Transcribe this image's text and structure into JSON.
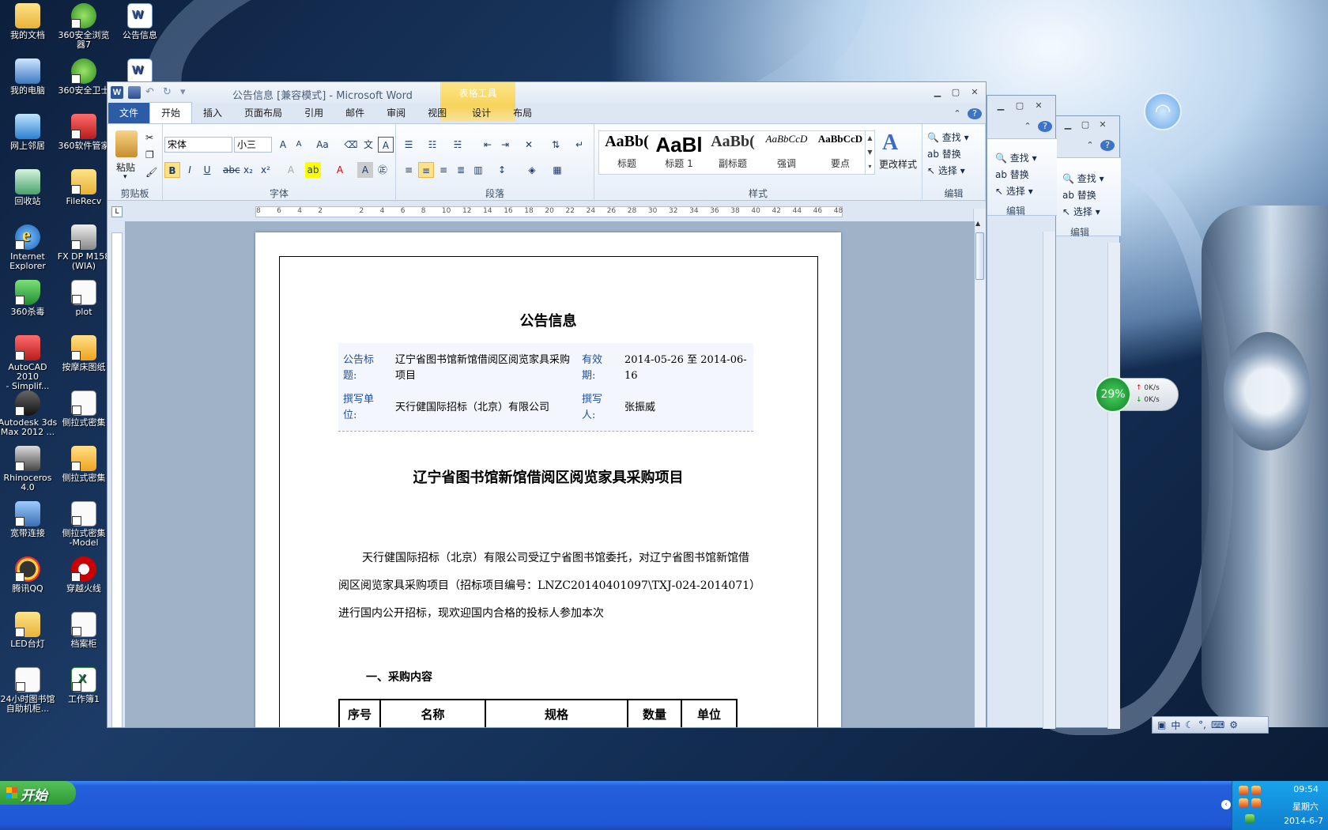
{
  "desktop_icons": [
    {
      "label": "我的文档",
      "icon": "folder-icon"
    },
    {
      "label": "360安全浏览\n器7",
      "icon": "browser-icon"
    },
    {
      "label": "公告信息",
      "icon": "word-doc-icon"
    },
    {
      "label": "我的电脑",
      "icon": "computer-icon"
    },
    {
      "label": "360安全卫士",
      "icon": "shield-icon"
    },
    {
      "label": "",
      "icon": "word-doc-icon"
    },
    {
      "label": "网上邻居",
      "icon": "network-icon"
    },
    {
      "label": "360软件管家",
      "icon": "app-manager-icon"
    },
    {
      "label": "回收站",
      "icon": "recycle-bin-icon"
    },
    {
      "label": "FileRecv",
      "icon": "folder-icon"
    },
    {
      "label": "Internet\nExplorer",
      "icon": "ie-icon"
    },
    {
      "label": "FX DP M158\n(WIA)",
      "icon": "scanner-icon"
    },
    {
      "label": "360杀毒",
      "icon": "antivirus-icon"
    },
    {
      "label": "plot",
      "icon": "file-icon"
    },
    {
      "label": "AutoCAD 2010\n- Simplif...",
      "icon": "autocad-icon"
    },
    {
      "label": "按摩床图纸",
      "icon": "dwg-icon"
    },
    {
      "label": "Autodesk 3ds\nMax 2012 ...",
      "icon": "3dsmax-icon"
    },
    {
      "label": "侧拉式密集",
      "icon": "file-icon"
    },
    {
      "label": "Rhinoceros\n4.0",
      "icon": "rhino-icon"
    },
    {
      "label": "侧拉式密集",
      "icon": "dwg-icon"
    },
    {
      "label": "宽带连接",
      "icon": "broadband-icon"
    },
    {
      "label": "侧拉式密集\n-Model",
      "icon": "file-icon"
    },
    {
      "label": "腾讯QQ",
      "icon": "qq-icon"
    },
    {
      "label": "穿越火线",
      "icon": "game-icon"
    },
    {
      "label": "LED台灯",
      "icon": "folder-icon"
    },
    {
      "label": "档案柜",
      "icon": "file-icon"
    },
    {
      "label": "24小时图书馆\n自助机柜...",
      "icon": "file-icon"
    },
    {
      "label": "工作簿1",
      "icon": "excel-icon"
    }
  ],
  "word": {
    "title": "公告信息 [兼容模式] - Microsoft Word",
    "context_tab": "表格工具",
    "tabs": [
      "文件",
      "开始",
      "插入",
      "页面布局",
      "引用",
      "邮件",
      "审阅",
      "视图",
      "设计",
      "布局"
    ],
    "font_name": "宋体",
    "font_size": "小三",
    "groups": {
      "clipboard": "剪贴板",
      "font": "字体",
      "paragraph": "段落",
      "styles": "样式",
      "editing": "编辑"
    },
    "paste_label": "粘贴",
    "styles": [
      {
        "preview": "AaBb(",
        "name": "标题"
      },
      {
        "preview": "AaBl",
        "name": "标题 1"
      },
      {
        "preview": "AaBb(",
        "name": "副标题"
      },
      {
        "preview": "AaBbCcD",
        "name": "强调"
      },
      {
        "preview": "AaBbCcD",
        "name": "要点"
      }
    ],
    "change_styles": "更改样式",
    "editing": {
      "find": "查找",
      "replace": "替换",
      "select": "选择"
    },
    "ruler_ticks": [
      "8",
      "6",
      "4",
      "2",
      "",
      "2",
      "4",
      "6",
      "8",
      "10",
      "12",
      "14",
      "16",
      "18",
      "20",
      "22",
      "24",
      "26",
      "28",
      "30",
      "32",
      "34",
      "36",
      "38",
      "40",
      "42",
      "44",
      "46",
      "48"
    ]
  },
  "document": {
    "heading": "公告信息",
    "meta": {
      "title_label": "公告标题:",
      "title_value": "辽宁省图书馆新馆借阅区阅览家具采购项目",
      "valid_label": "有效期:",
      "valid_value": "2014-05-26 至 2014-06-16",
      "author_unit_label": "撰写单位:",
      "author_unit_value": "天行健国际招标（北京）有限公司",
      "author_label": "撰写人:",
      "author_value": "张振威"
    },
    "title": "辽宁省图书馆新馆借阅区阅览家具采购项目",
    "paragraph": "天行健国际招标（北京）有限公司受辽宁省图书馆委托，对辽宁省图书馆新馆借阅区阅览家具采购项目（招标项目编号：LNZC20140401097\\TXJ-024-2014071）进行国内公开招标，现欢迎国内合格的投标人参加本次",
    "section": "一、采购内容",
    "table_headers": [
      "序号",
      "名称",
      "规格",
      "数量",
      "单位"
    ]
  },
  "side_windows": {
    "find": "查找",
    "replace": "替换",
    "select": "选择",
    "group": "编辑"
  },
  "netmon": {
    "percent": "29%",
    "up": "0K/s",
    "down": "0K/s"
  },
  "ime_label": "中",
  "taskbar": {
    "start": "开始",
    "time": "09:54",
    "weekday": "星期六",
    "date": "2014-6-7"
  }
}
